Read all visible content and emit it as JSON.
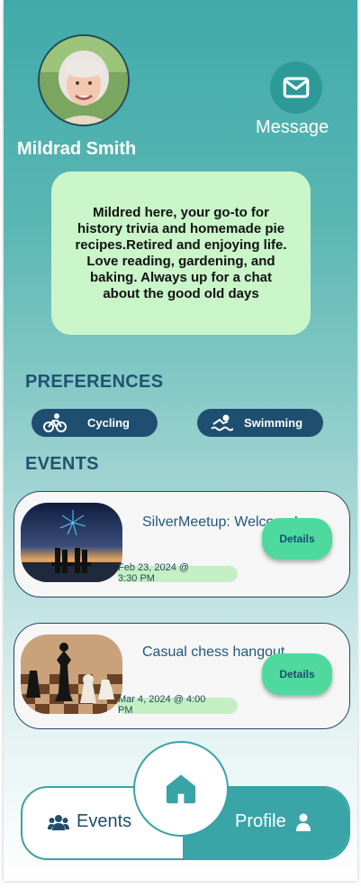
{
  "profile": {
    "name": "Mildrad Smith",
    "message_label": "Message",
    "bio": "Mildred here, your go-to for history trivia and homemade pie recipes.Retired and enjoying life. Love reading, gardening, and baking. Always up for a chat about the good old days"
  },
  "preferences": {
    "title": "PREFERENCES",
    "items": [
      {
        "label": "Cycling",
        "icon": "cycling-icon"
      },
      {
        "label": "Swimming",
        "icon": "swimming-icon"
      }
    ]
  },
  "events": {
    "title": "EVENTS",
    "items": [
      {
        "title": "SilverMeetup: Welcome!",
        "date": "Feb 23, 2024 @ 3:30 PM",
        "details_label": "Details",
        "image": "fireworks-lake-image"
      },
      {
        "title": "Casual chess hangout",
        "date": "Mar 4, 2024 @ 4:00 PM",
        "details_label": "Details",
        "image": "chess-board-image"
      }
    ]
  },
  "nav": {
    "events_label": "Events",
    "profile_label": "Profile",
    "home_icon": "home-icon"
  },
  "colors": {
    "teal": "#3aa5a7",
    "navy": "#1f4f70",
    "mint": "#4ed99f",
    "bio_bg": "#c9f5c9"
  }
}
